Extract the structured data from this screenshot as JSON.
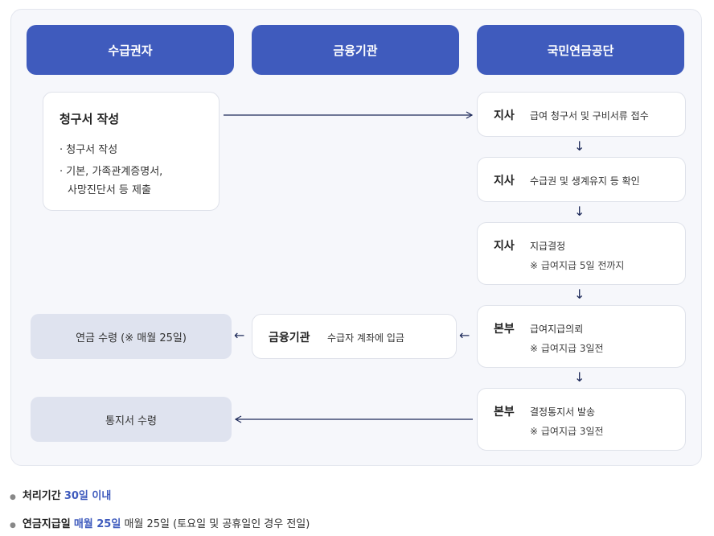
{
  "headers": {
    "recipient": "수급권자",
    "bank": "금융기관",
    "nps": "국민연금공단"
  },
  "left_card": {
    "title": "청구서 작성",
    "item1": "· 청구서 작성",
    "item2": "· 기본, 가족관계증명서,",
    "item2_cont": "사망진단서 등 제출"
  },
  "steps": [
    {
      "office": "지사",
      "text": "급여 청구서 및 구비서류 접수",
      "note": ""
    },
    {
      "office": "지사",
      "text": "수급권 및 생계유지 등 확인",
      "note": ""
    },
    {
      "office": "지사",
      "text": "지급결정",
      "note": "※ 급여지급 5일 전까지"
    },
    {
      "office": "본부",
      "text": "급여지급의뢰",
      "note": "※ 급여지급 3일전"
    },
    {
      "office": "본부",
      "text": "결정통지서 발송",
      "note": "※ 급여지급 3일전"
    }
  ],
  "bank_card": {
    "title": "금융기관",
    "text": "수급자 계좌에 입금"
  },
  "pension_receive": "연금 수령 (※ 매월 25일)",
  "notice_receive": "통지서 수령",
  "arrows": {
    "down": "↓",
    "left": "←"
  },
  "footer": {
    "period_label": "처리기간",
    "period_value": "30일 이내",
    "payday_label": "연금지급일",
    "payday_value": "매월 25일",
    "payday_note": "매월 25일 (토요일 및 공휴일인 경우 전일)"
  }
}
